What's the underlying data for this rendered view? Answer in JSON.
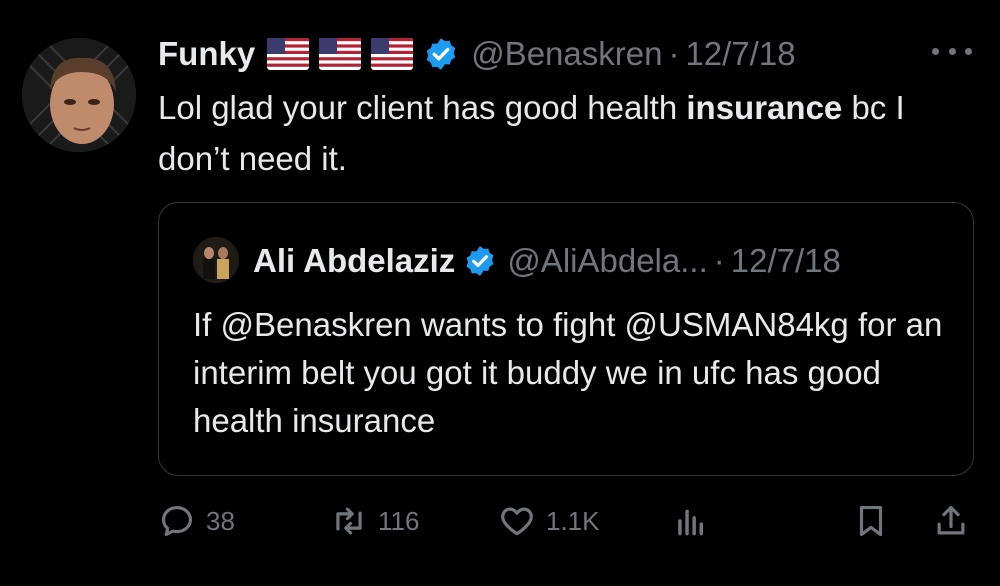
{
  "tweet": {
    "author_name": "Funky",
    "flags": [
      "us-flag",
      "us-flag",
      "us-flag"
    ],
    "handle": "@Benaskren",
    "dot": "·",
    "date": "12/7/18",
    "text_before": "Lol glad your client has good health ",
    "text_bold": "insurance",
    "text_after": " bc I don’t need it."
  },
  "quoted": {
    "author_name": "Ali Abdelaziz",
    "handle": "@AliAbdela...",
    "dot": "·",
    "date": "12/7/18",
    "text": "If @Benaskren wants to fight @USMAN84kg for an interim belt you got it buddy we in ufc has good health insurance"
  },
  "actions": {
    "replies": "38",
    "retweets": "116",
    "likes": "1.1K"
  },
  "colors": {
    "background": "#000000",
    "text": "#e7e9ea",
    "muted": "#71767b",
    "verified": "#1d9bf0",
    "border": "#333639"
  },
  "icons": [
    "more-icon",
    "verified-icon",
    "reply-icon",
    "retweet-icon",
    "like-icon",
    "views-icon",
    "bookmark-icon",
    "share-icon"
  ]
}
